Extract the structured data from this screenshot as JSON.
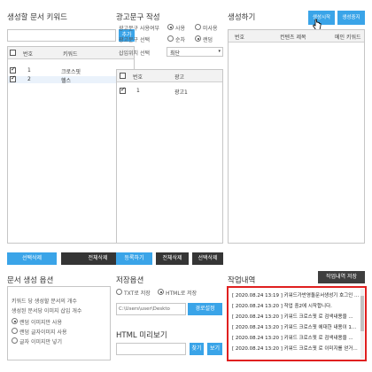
{
  "keyword": {
    "title": "생성할 문서 키워드",
    "add_label": "추가",
    "col_no": "번호",
    "col_keyword": "키워드",
    "rows": [
      {
        "no": "1",
        "keyword": "크로스핏",
        "checked": true
      },
      {
        "no": "2",
        "keyword": "헬스",
        "checked": true
      }
    ],
    "btn_delete_selected": "선택삭제",
    "btn_delete_all": "전체삭제"
  },
  "ad": {
    "title": "광고문구 작성",
    "use_label": "광고문구 사용여부",
    "use_yes": "사용",
    "use_no": "미사용",
    "select_label": "광고문구 선택",
    "select_seq": "순차",
    "select_random": "랜덤",
    "position_label": "삽입위치 선택",
    "position_value": "최단",
    "col_no": "번호",
    "col_ad": "광고",
    "rows": [
      {
        "no": "1",
        "ad": "광고1",
        "checked": true
      }
    ],
    "btn_register": "등록하기",
    "btn_delete_all": "전체삭제",
    "btn_delete_selected": "선택삭제"
  },
  "generate": {
    "title": "생성하기",
    "btn_start": "생성시작",
    "btn_stop": "생성중지",
    "col_no": "번호",
    "col_content": "컨텐츠 제목",
    "col_keyword": "메인 키워드"
  },
  "options": {
    "title": "문서 생성 옵션",
    "count_label_1": "키워드 당 생성할 문서의 개수",
    "count_label_2": "생성된 문서당 이미지 삽입 개수",
    "image_options": [
      "랜덤 이미지만 사용",
      "랜덤 글자이미지 사용",
      "글자 이미지만 넣기"
    ],
    "image_selected": 0
  },
  "save": {
    "title": "저장옵션",
    "txt_label": "TXT로 저장",
    "html_label": "HTML로 저장",
    "path_value": "C:\\Users\\user\\Deskto",
    "btn_path": "경로설정"
  },
  "preview": {
    "title": "HTML 미리보기",
    "btn_find": "찾기",
    "btn_view": "보기"
  },
  "log": {
    "title": "작업내역",
    "btn_save": "작업내역 저장",
    "lines": [
      "[ 2020.08.24 13:19 ]  키워드가반영돌문서생성기 호그인 ...",
      "[ 2020.08.24 13:20 ]  작업 중2에 시작합니다.",
      "[ 2020.08.24 13:20 ]  키워드 크로스핏 로 검색내용을 ...",
      "[ 2020.08.24 13:20 ]  키워드 크로스핏 에대한 내용이 1...",
      "[ 2020.08.24 13:20 ]  키워드 크로스핏 로 검색내용을 ...",
      "[ 2020.08.24 13:20 ]  키워드 크로스핏 로 이미지를 얻거..."
    ],
    "highlight_color": "#e02020"
  },
  "colors": {
    "accent": "#3aa4e8",
    "dark_button": "#353535"
  }
}
